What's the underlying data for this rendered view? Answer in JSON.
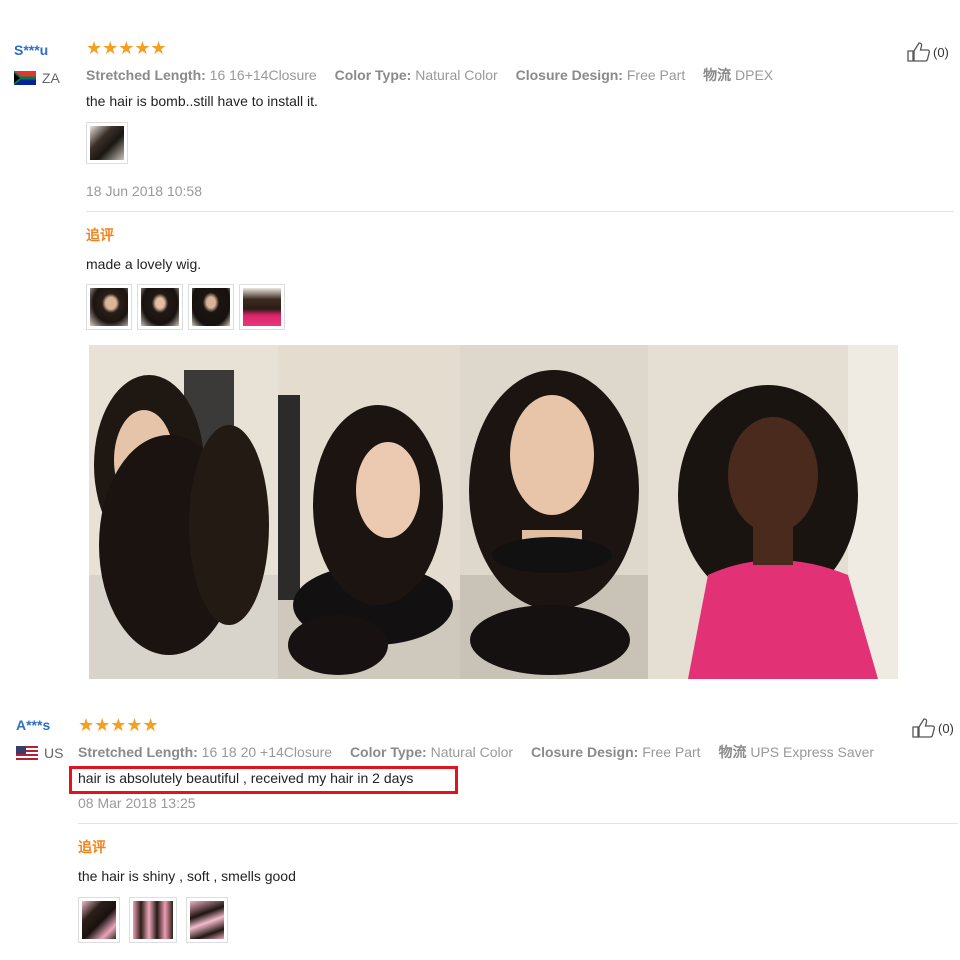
{
  "reviews": [
    {
      "user": "S***u",
      "country": "ZA",
      "stars": "★★★★★",
      "attrs": [
        {
          "key": "Stretched Length:",
          "value": "16 16+14Closure"
        },
        {
          "key": "Color Type:",
          "value": "Natural Color"
        },
        {
          "key": "Closure Design:",
          "value": "Free Part"
        },
        {
          "key": "物流",
          "value": "DPEX"
        }
      ],
      "text": "the hair is bomb..still have to install it.",
      "date": "18 Jun 2018 10:58",
      "likes": "(0)",
      "followup_label": "追评",
      "followup_text": "made a lovely wig."
    },
    {
      "user": "A***s",
      "country": "US",
      "stars": "★★★★★",
      "attrs": [
        {
          "key": "Stretched Length:",
          "value": "16 18 20 +14Closure"
        },
        {
          "key": "Color Type:",
          "value": "Natural Color"
        },
        {
          "key": "Closure Design:",
          "value": "Free Part"
        },
        {
          "key": "物流",
          "value": "UPS Express Saver"
        }
      ],
      "text": "hair is absolutely beautiful , received my hair in 2 days",
      "date": "08 Mar 2018 13:25",
      "likes": "(0)",
      "followup_label": "追评",
      "followup_text": "the hair is shiny , soft , smells good"
    }
  ],
  "colors": {
    "username": "#2f6fc2",
    "star": "#f59f1f",
    "followup": "#f0821e",
    "highlight": "#e0141c"
  }
}
